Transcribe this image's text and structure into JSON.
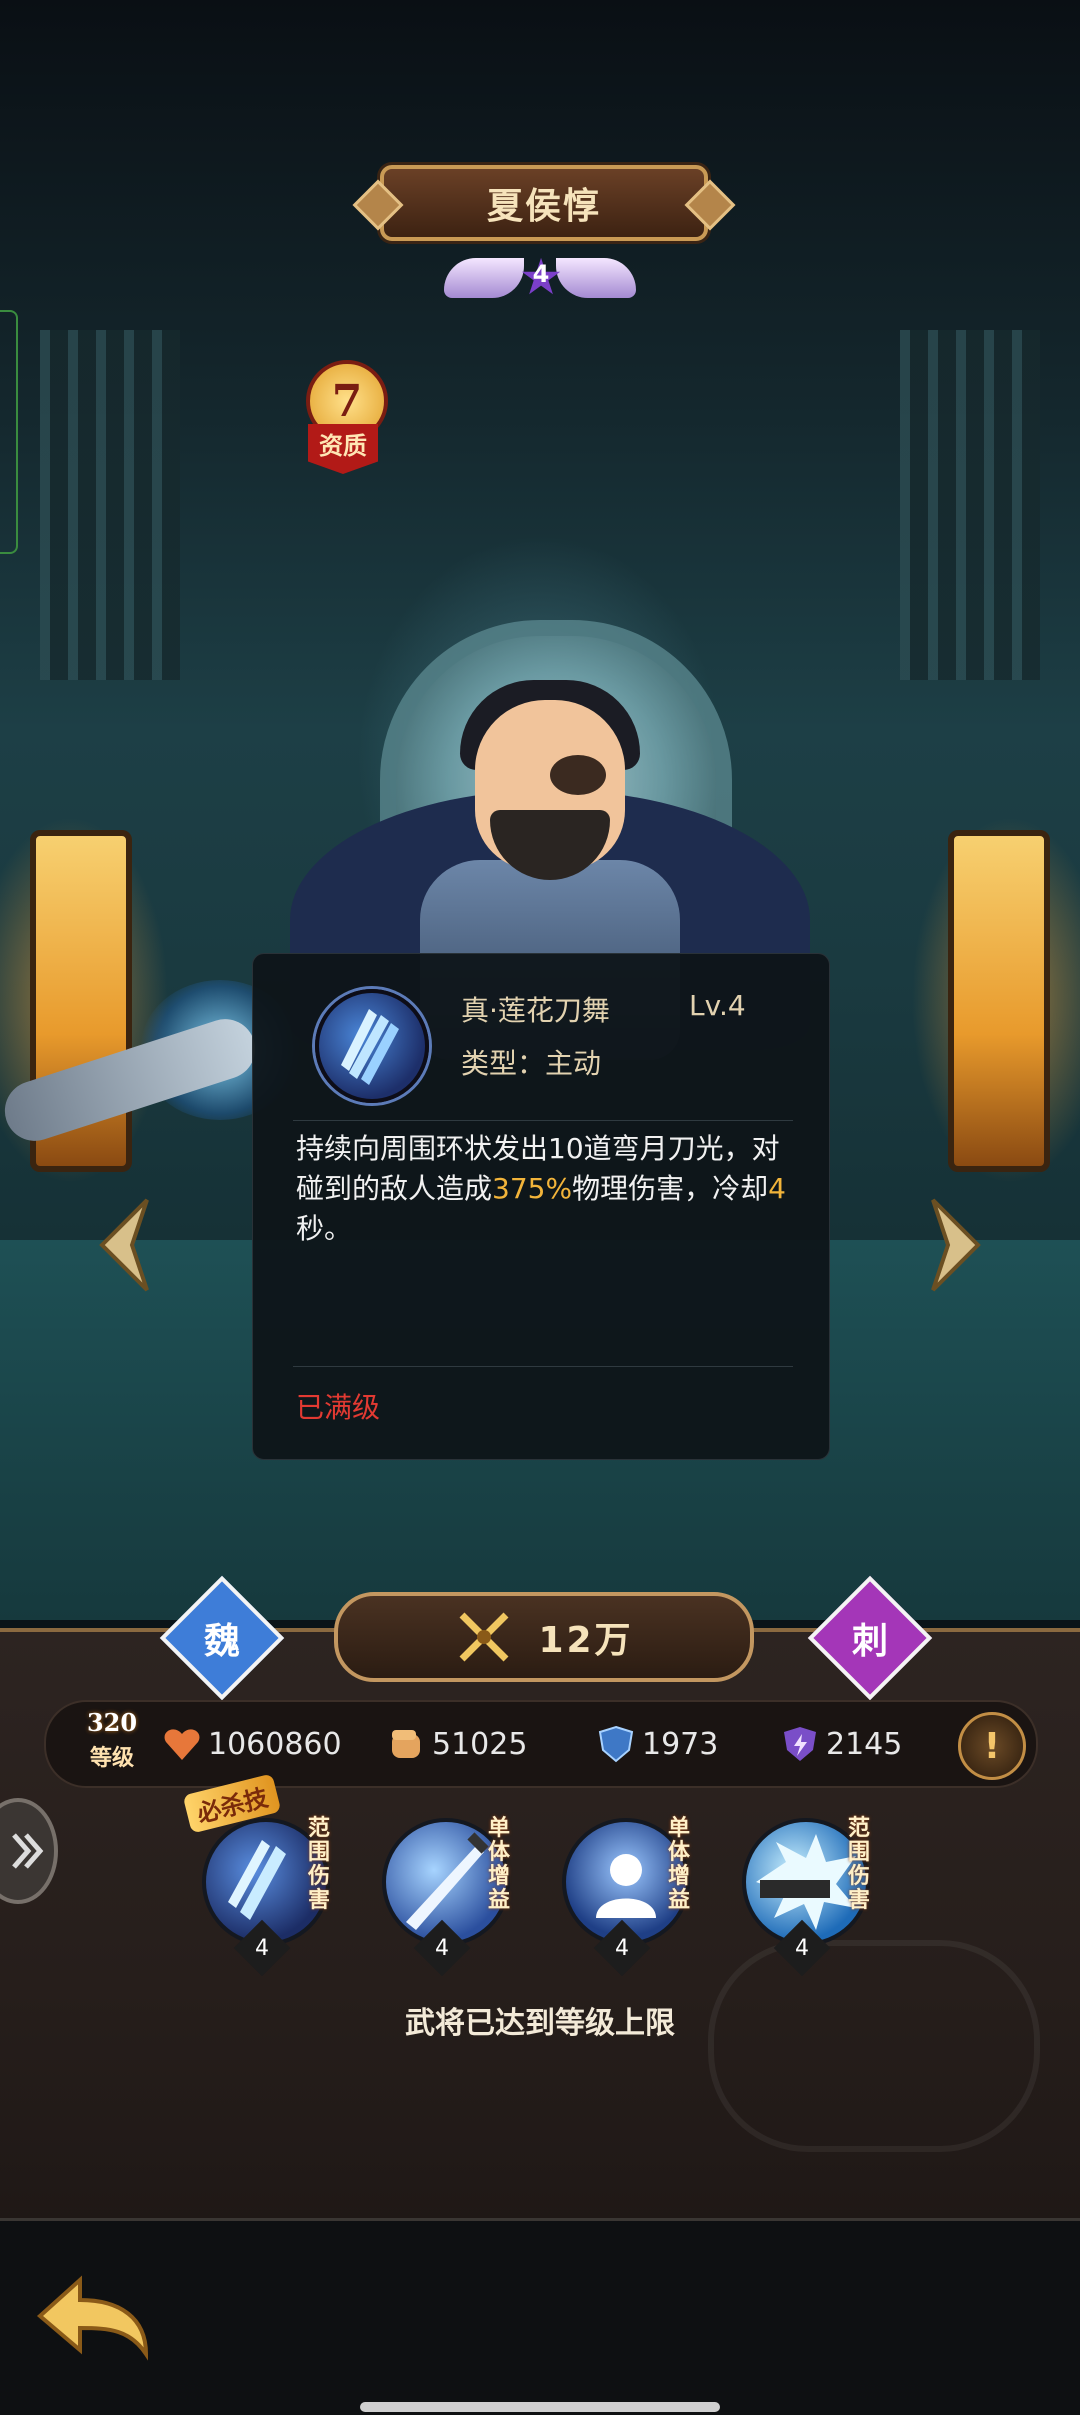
{
  "hero": {
    "name": "夏侯惇",
    "star_level": "4",
    "quality_value": "7",
    "quality_label": "资质",
    "faction": "魏",
    "role": "刺",
    "power": "12万",
    "level_value": "320",
    "level_label": "等级"
  },
  "stats": {
    "hp": "1060860",
    "attack": "51025",
    "defense": "1973",
    "magic_defense": "2145"
  },
  "popup": {
    "skill_name": "真·莲花刀舞",
    "skill_level": "Lv.4",
    "skill_type": "类型：主动",
    "desc_part1": "持续向周围环状发出10道弯月刀光，对碰到的敌人造成",
    "desc_highlight1": "375%",
    "desc_part2": "物理伤害，冷却",
    "desc_highlight2": "4",
    "desc_part3": "秒。",
    "status": "已满级"
  },
  "skills": [
    {
      "tag": "范围伤害",
      "level": "4",
      "ultimate_label": "必杀技",
      "icon": "triple-blade-icon",
      "color": "#2d4aa8"
    },
    {
      "tag": "单体增益",
      "level": "4",
      "icon": "sword-strike-icon",
      "color": "#3a6fc8"
    },
    {
      "tag": "单体增益",
      "level": "4",
      "icon": "silhouette-icon",
      "color": "#4d7fd0"
    },
    {
      "tag": "范围伤害",
      "level": "4",
      "icon": "spiky-burst-icon",
      "color": "#2f9ad8"
    }
  ],
  "max_level_notice": "武将已达到等级上限",
  "colors": {
    "accent_gold": "#c99a55",
    "highlight": "#f2b43a",
    "maxed_red": "#e23a32",
    "faction_blue": "#3e7dd8",
    "role_purple": "#a436b8"
  }
}
